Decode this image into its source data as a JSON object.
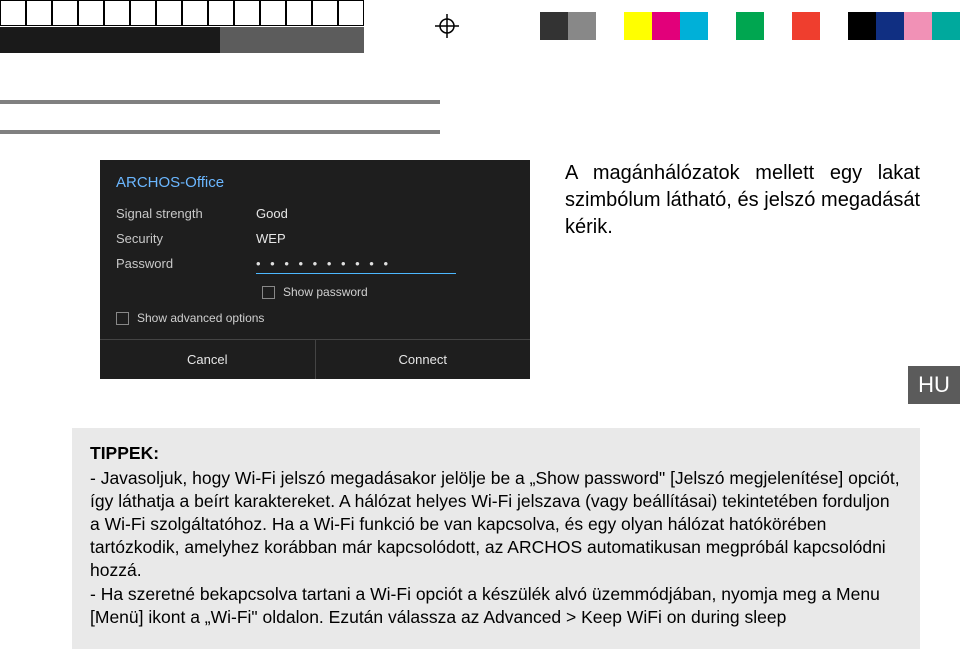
{
  "registration": {
    "colors": [
      "#333333",
      "#888888",
      "#ffff00",
      "#00b0d8",
      "#00a650",
      "#e2007a",
      "#ef3e2e",
      "#ffffff",
      "#000000",
      "#102f82",
      "#f191b6",
      "#00a99d"
    ]
  },
  "wifi": {
    "title": "ARCHOS-Office",
    "signal_label": "Signal strength",
    "signal_value": "Good",
    "security_label": "Security",
    "security_value": "WEP",
    "password_label": "Password",
    "password_masked": "•  •  •  •  •  •  •  •  •  •",
    "show_password": "Show password",
    "show_advanced": "Show advanced options",
    "cancel": "Cancel",
    "connect": "Connect"
  },
  "caption": "A magánhálózatok mellett egy lakat szimbólum látható, és jelszó megadását kérik.",
  "lang_badge": "HU",
  "tips": {
    "title": "TIPPEK:",
    "item1": "-  Javasoljuk, hogy Wi-Fi jelszó megadásakor jelölje be a „Show password\" [Jelszó megjelenítése] opciót, így láthatja a beírt karaktereket. A hálózat helyes Wi-Fi jelszava (vagy beállításai) tekintetében forduljon a Wi-Fi szolgáltatóhoz. Ha a Wi-Fi funkció be van kapcsolva, és egy olyan hálózat hatókörében tartózkodik, amelyhez korábban már kapcsolódott, az ARCHOS automatikusan megpróbál kapcsolódni hozzá.",
    "item2": "-  Ha szeretné bekapcsolva tartani a Wi-Fi opciót a készülék alvó üzemmódjában, nyomja meg a Menu [Menü] ikont a „Wi-Fi\" oldalon. Ezután válassza az Advanced > Keep WiFi on during sleep"
  }
}
